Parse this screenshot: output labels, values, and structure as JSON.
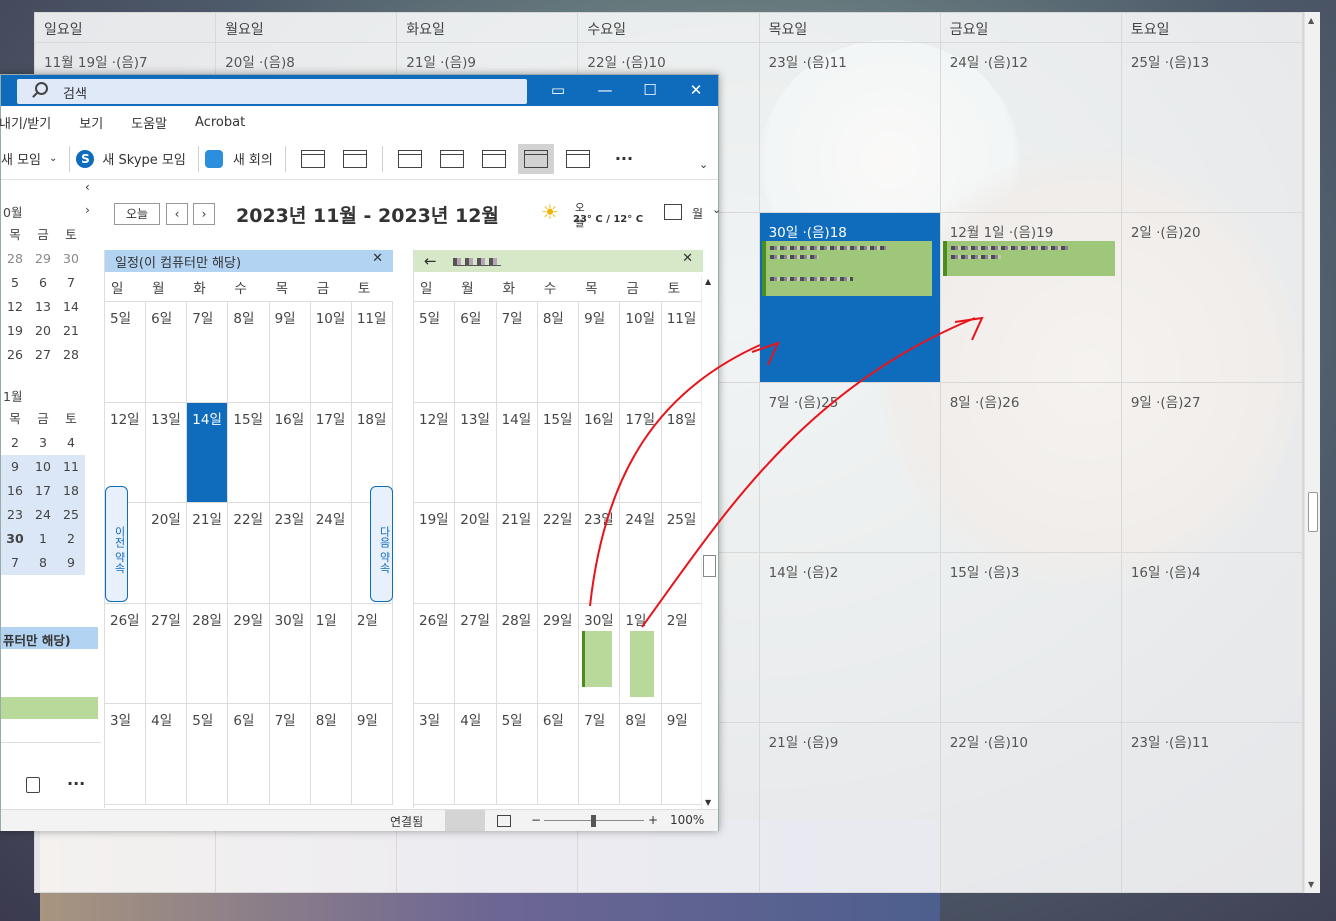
{
  "background_calendar": {
    "weekdays": [
      "일요일",
      "월요일",
      "화요일",
      "수요일",
      "목요일",
      "금요일",
      "토요일"
    ],
    "weeks": [
      [
        "11월 19일 ·(음)7",
        "20일 ·(음)8",
        "21일 ·(음)9",
        "22일 ·(음)10",
        "23일 ·(음)11",
        "24일 ·(음)12",
        "25일 ·(음)13"
      ],
      [
        "",
        "",
        "",
        "",
        "30일 ·(음)18",
        "12월 1일 ·(음)19",
        "2일 ·(음)20"
      ],
      [
        "",
        "",
        "",
        "",
        "7일 ·(음)25",
        "8일 ·(음)26",
        "9일 ·(음)27"
      ],
      [
        "",
        "",
        "",
        "",
        "14일 ·(음)2",
        "15일 ·(음)3",
        "16일 ·(음)4"
      ],
      [
        "",
        "",
        "",
        "",
        "21일 ·(음)9",
        "22일 ·(음)10",
        "23일 ·(음)11"
      ]
    ]
  },
  "window": {
    "search_placeholder": "검색",
    "menu": [
      "내기/받기",
      "보기",
      "도움말",
      "Acrobat"
    ],
    "ribbon": {
      "new_group": "새 모임",
      "skype": "새 Skype 모임",
      "teams": "새 회의",
      "more": "···"
    }
  },
  "left_nav": {
    "month1": "0월",
    "mini1_head": [
      "목",
      "금",
      "토"
    ],
    "mini1": [
      [
        "28",
        "29",
        "30"
      ],
      [
        "5",
        "6",
        "7"
      ],
      [
        "12",
        "13",
        "14"
      ],
      [
        "19",
        "20",
        "21"
      ],
      [
        "26",
        "27",
        "28"
      ]
    ],
    "month2": "1월",
    "mini2_head": [
      "목",
      "금",
      "토"
    ],
    "mini2": [
      [
        "2",
        "3",
        "4"
      ],
      [
        "9",
        "10",
        "11"
      ],
      [
        "16",
        "17",
        "18"
      ],
      [
        "23",
        "24",
        "25"
      ],
      [
        "30",
        "1",
        "2"
      ],
      [
        "7",
        "8",
        "9"
      ]
    ],
    "selected_calendar": "퓨터만 해당)"
  },
  "main": {
    "today_button": "오늘",
    "date_range": "2023년 11월 - 2023년 12월",
    "weather": {
      "label": "오늘",
      "temp": "23° C / 12° C"
    },
    "view_label": "월",
    "pane1": {
      "title": "일정(이 컴퓨터만 해당)",
      "dow": [
        "일",
        "월",
        "화",
        "수",
        "목",
        "금",
        "토"
      ],
      "weeks": [
        [
          "5일",
          "6일",
          "7일",
          "8일",
          "9일",
          "10일",
          "11일"
        ],
        [
          "12일",
          "13일",
          "14일",
          "15일",
          "16일",
          "17일",
          "18일"
        ],
        [
          "",
          "20일",
          "21일",
          "22일",
          "23일",
          "24일",
          ""
        ],
        [
          "26일",
          "27일",
          "28일",
          "29일",
          "30일",
          "1일",
          "2일"
        ],
        [
          "3일",
          "4일",
          "5일",
          "6일",
          "7일",
          "8일",
          "9일"
        ]
      ],
      "prev_tab": "이전 약속",
      "next_tab": "다음 약속"
    },
    "pane2": {
      "title": "",
      "dow": [
        "일",
        "월",
        "화",
        "수",
        "목",
        "금",
        "토"
      ],
      "weeks": [
        [
          "5일",
          "6일",
          "7일",
          "8일",
          "9일",
          "10일",
          "11일"
        ],
        [
          "12일",
          "13일",
          "14일",
          "15일",
          "16일",
          "17일",
          "18일"
        ],
        [
          "19일",
          "20일",
          "21일",
          "22일",
          "23일",
          "24일",
          "25일"
        ],
        [
          "26일",
          "27일",
          "28일",
          "29일",
          "30일",
          "1일",
          "2일"
        ],
        [
          "3일",
          "4일",
          "5일",
          "6일",
          "7일",
          "8일",
          "9일"
        ]
      ]
    }
  },
  "status": {
    "connected": "연결됨",
    "zoom": "100%"
  },
  "colors": {
    "accent": "#0f6cbd",
    "event_green": "#9fc77a",
    "annotation_red": "#e8141b"
  }
}
